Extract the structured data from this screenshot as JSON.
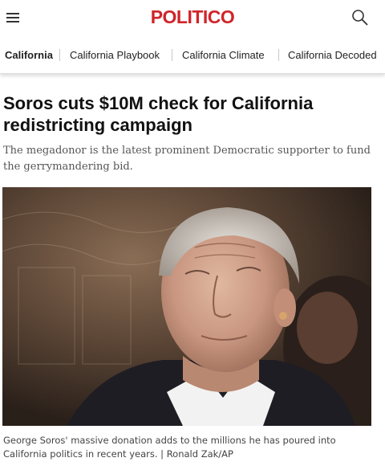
{
  "header": {
    "logo_text": "POLITICO",
    "logo_color": "#d1242a",
    "menu_icon": "hamburger-menu-icon",
    "search_icon": "search-icon"
  },
  "subnav": {
    "items": [
      {
        "label": "California",
        "active": true
      },
      {
        "label": "California Playbook",
        "active": false
      },
      {
        "label": "California Climate",
        "active": false
      },
      {
        "label": "California Decoded",
        "active": false
      }
    ]
  },
  "article": {
    "headline": "Soros cuts $10M check for California redistricting campaign",
    "dek": "The megadonor is the latest prominent Democratic supporter to fund the gerrymandering bid.",
    "caption": "George Soros' massive donation adds to the millions he has poured into California politics in recent years. | Ronald Zak/AP"
  }
}
